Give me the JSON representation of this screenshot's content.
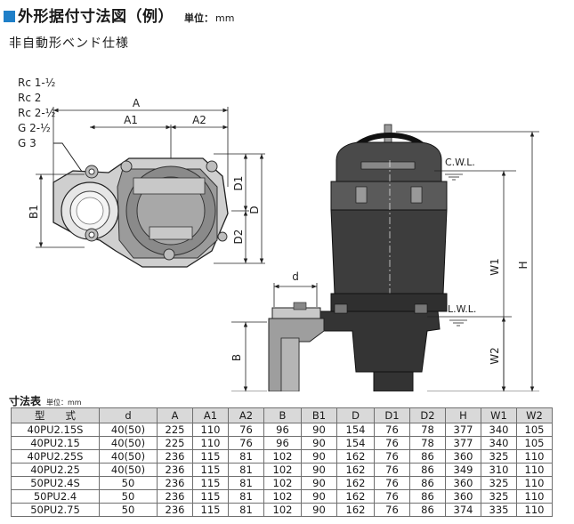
{
  "title": "外形据付寸法図（例）",
  "unit_label": "単位：",
  "unit_value": "mm",
  "subtitle": "非自動形ベンド仕様",
  "drawing": {
    "connection_labels": [
      "Rc 1-½",
      "Rc 2",
      "Rc 2-½",
      "G 2-½",
      "G 3"
    ],
    "dimension_labels": [
      "A",
      "A1",
      "A2",
      "B1",
      "D1",
      "D2",
      "D",
      "d",
      "B",
      "W1",
      "W2",
      "H"
    ],
    "water_levels": [
      "C.W.L.",
      "L.W.L."
    ]
  },
  "table": {
    "caption": "寸法表",
    "caption_unit": "単位：mm",
    "headers": [
      "型　　式",
      "d",
      "A",
      "A1",
      "A2",
      "B",
      "B1",
      "D",
      "D1",
      "D2",
      "H",
      "W1",
      "W2"
    ],
    "rows": [
      [
        "40PU2.15S",
        "40(50)",
        "225",
        "110",
        "76",
        "96",
        "90",
        "154",
        "76",
        "78",
        "377",
        "340",
        "105"
      ],
      [
        "40PU2.15",
        "40(50)",
        "225",
        "110",
        "76",
        "96",
        "90",
        "154",
        "76",
        "78",
        "377",
        "340",
        "105"
      ],
      [
        "40PU2.25S",
        "40(50)",
        "236",
        "115",
        "81",
        "102",
        "90",
        "162",
        "76",
        "86",
        "360",
        "325",
        "110"
      ],
      [
        "40PU2.25",
        "40(50)",
        "236",
        "115",
        "81",
        "102",
        "90",
        "162",
        "76",
        "86",
        "349",
        "310",
        "110"
      ],
      [
        "50PU2.4S",
        "50",
        "236",
        "115",
        "81",
        "102",
        "90",
        "162",
        "76",
        "86",
        "360",
        "325",
        "110"
      ],
      [
        "50PU2.4",
        "50",
        "236",
        "115",
        "81",
        "102",
        "90",
        "162",
        "76",
        "86",
        "360",
        "325",
        "110"
      ],
      [
        "50PU2.75",
        "50",
        "236",
        "115",
        "81",
        "102",
        "90",
        "162",
        "76",
        "86",
        "374",
        "335",
        "110"
      ]
    ]
  }
}
